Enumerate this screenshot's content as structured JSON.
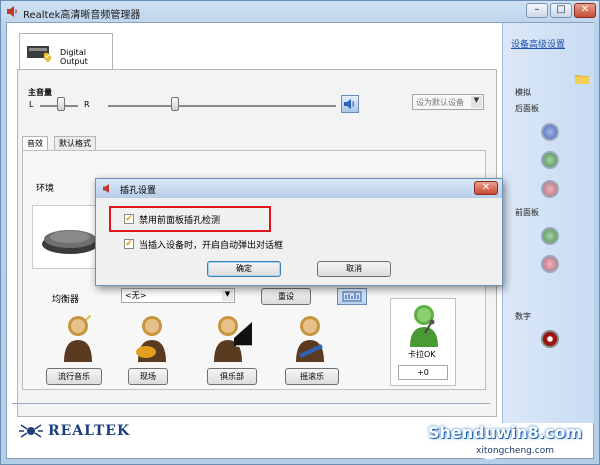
{
  "window": {
    "title": "Realtek高清晰音频管理器",
    "min_btn": "–",
    "restore_btn": "□",
    "close_btn": "✕"
  },
  "right_panel": {
    "advanced_link": "设备高级设置",
    "analog_label": "模拟",
    "rear_panel_label": "后面板",
    "front_panel_label": "前面板",
    "digital_label": "数字",
    "rear_jacks": [
      "#6a86c9",
      "#6aa76c",
      "#c98a95"
    ],
    "front_jacks": [
      "#6aa76c",
      "#c98a95"
    ],
    "digital_jack": "#b01818"
  },
  "device_tab": {
    "label": "Digital Output",
    "icon": "speaker-device-icon"
  },
  "volume": {
    "title": "主音量",
    "left": "L",
    "right": "R",
    "default_device": "设为默认设备"
  },
  "tabs": [
    "音效",
    "默认格式"
  ],
  "effects": {
    "environment_label": "环境",
    "equalizer_label": "均衡器",
    "equalizer_value": "<无>",
    "reset_button": "重设",
    "presets": [
      "流行音乐",
      "现场",
      "俱乐部",
      "摇滚乐"
    ],
    "karaoke_label": "卡拉OK",
    "karaoke_value": "+0"
  },
  "brand": {
    "logo_text": "REALTEK"
  },
  "dialog": {
    "title": "插孔设置",
    "option1": "禁用前面板插孔检测",
    "option1_checked": true,
    "option2": "当插入设备时，开启自动弹出对话框",
    "option2_checked": true,
    "ok_button": "确定",
    "cancel_button": "取消",
    "close_btn": "✕"
  },
  "watermark": {
    "main": "Shenduwin8.com",
    "sub": "xitongcheng.com"
  }
}
